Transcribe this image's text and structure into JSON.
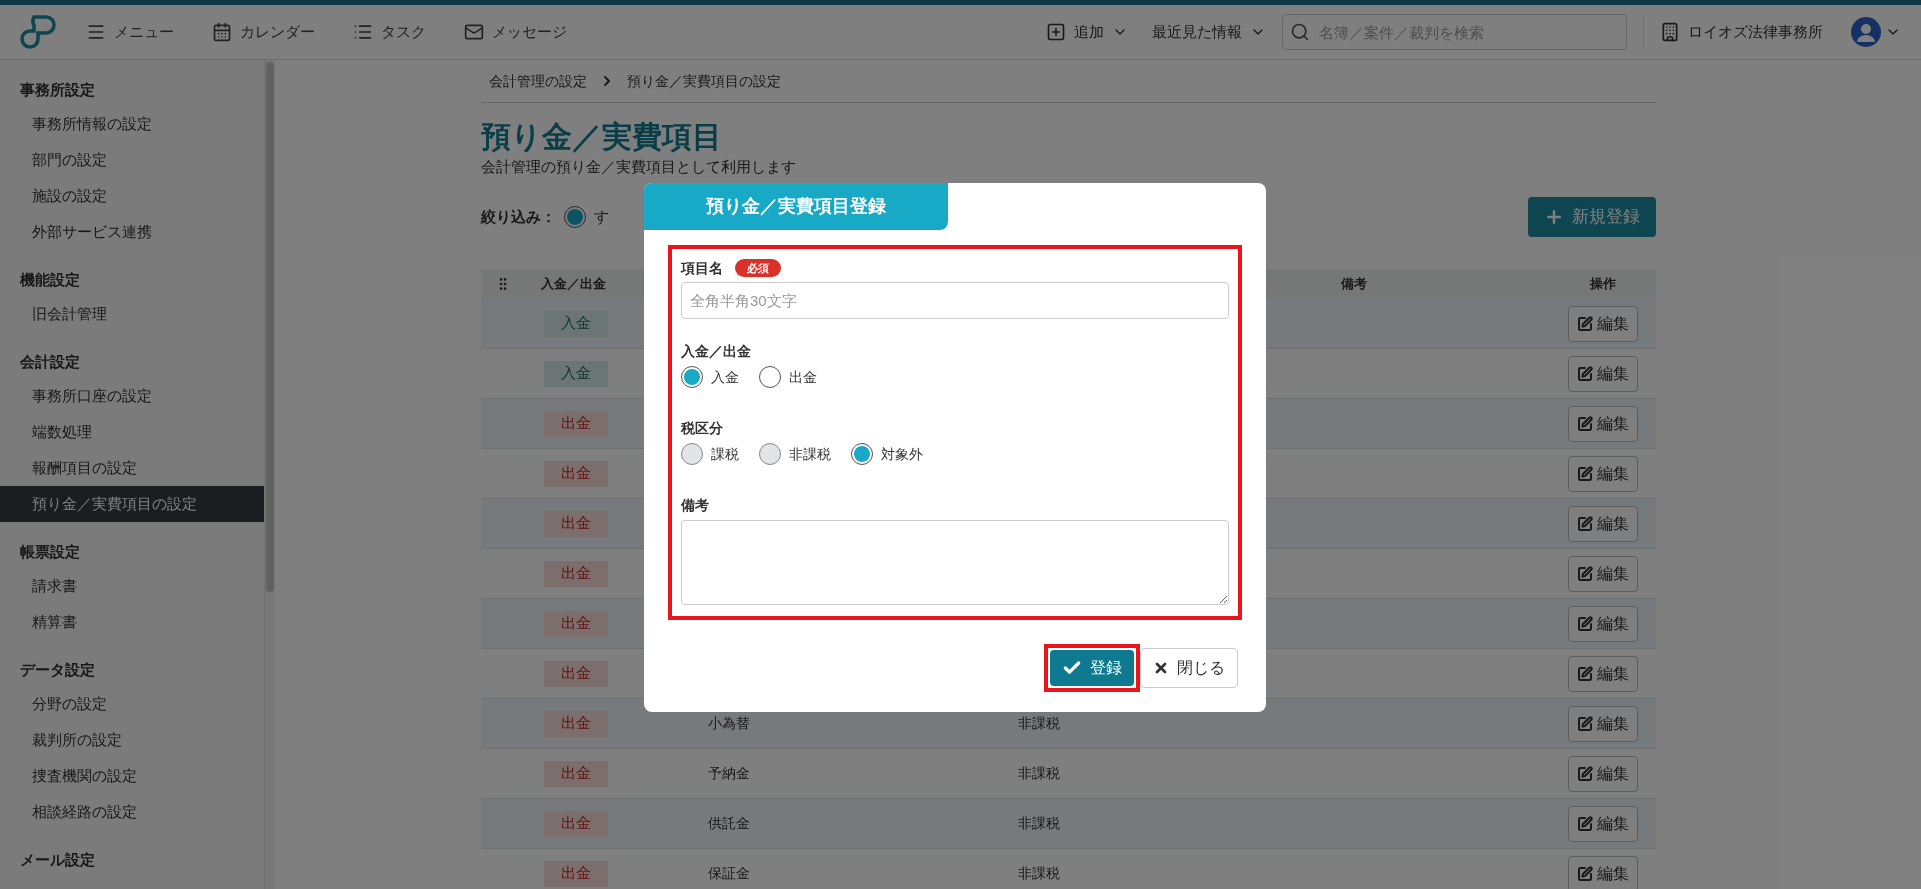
{
  "header": {
    "nav": [
      {
        "kind": "menu",
        "label": "メニュー"
      },
      {
        "kind": "calendar",
        "label": "カレンダー"
      },
      {
        "kind": "task",
        "label": "タスク"
      },
      {
        "kind": "message",
        "label": "メッセージ"
      }
    ],
    "add": "追加",
    "recent": "最近見た情報",
    "search": {
      "placeholder": "名簿／案件／裁判を検索"
    },
    "office": "ロイオズ法律事務所"
  },
  "sidebar": [
    {
      "title": "事務所設定",
      "items": [
        {
          "label": "事務所情報の設定",
          "selected": false
        },
        {
          "label": "部門の設定",
          "selected": false
        },
        {
          "label": "施設の設定",
          "selected": false
        },
        {
          "label": "外部サービス連携",
          "selected": false
        }
      ]
    },
    {
      "title": "機能設定",
      "items": [
        {
          "label": "旧会計管理",
          "selected": false
        }
      ]
    },
    {
      "title": "会計設定",
      "items": [
        {
          "label": "事務所口座の設定",
          "selected": false
        },
        {
          "label": "端数処理",
          "selected": false
        },
        {
          "label": "報酬項目の設定",
          "selected": false
        },
        {
          "label": "預り金／実費項目の設定",
          "selected": true
        }
      ]
    },
    {
      "title": "帳票設定",
      "items": [
        {
          "label": "請求書",
          "selected": false
        },
        {
          "label": "精算書",
          "selected": false
        }
      ]
    },
    {
      "title": "データ設定",
      "items": [
        {
          "label": "分野の設定",
          "selected": false
        },
        {
          "label": "裁判所の設定",
          "selected": false
        },
        {
          "label": "捜査機関の設定",
          "selected": false
        },
        {
          "label": "相談経路の設定",
          "selected": false
        }
      ]
    },
    {
      "title": "メール設定"
    }
  ],
  "breadcrumb": [
    "会計管理の設定",
    "預り金／実費項目の設定"
  ],
  "page": {
    "title": "預り金／実費項目",
    "description": "会計管理の預り金／実費項目として利用します",
    "filter": {
      "label": "絞り込み：",
      "option": {
        "label": "す",
        "selected": true
      }
    },
    "new_button": "新規登録"
  },
  "table": {
    "columns": {
      "type": "入金／出金",
      "note": "備考",
      "action": "操作"
    },
    "rows": [
      {
        "kind": "in",
        "type": "入金",
        "action": "編集"
      },
      {
        "kind": "in",
        "type": "入金",
        "action": "編集"
      },
      {
        "kind": "out",
        "type": "出金",
        "action": "編集"
      },
      {
        "kind": "out",
        "type": "出金",
        "action": "編集"
      },
      {
        "kind": "out",
        "type": "出金",
        "action": "編集"
      },
      {
        "kind": "out",
        "type": "出金",
        "action": "編集"
      },
      {
        "kind": "out",
        "type": "出金",
        "action": "編集"
      },
      {
        "kind": "out",
        "type": "出金",
        "action": "編集"
      },
      {
        "kind": "out",
        "type": "出金",
        "name": "小為替",
        "tax": "非課税",
        "action": "編集"
      },
      {
        "kind": "out",
        "type": "出金",
        "name": "予納金",
        "tax": "非課税",
        "action": "編集"
      },
      {
        "kind": "out",
        "type": "出金",
        "name": "供託金",
        "tax": "非課税",
        "action": "編集"
      },
      {
        "kind": "out",
        "type": "出金",
        "name": "保証金",
        "tax": "非課税",
        "action": "編集"
      }
    ]
  },
  "modal": {
    "title": "預り金／実費項目登録",
    "highlighted": true,
    "name": {
      "label": "項目名",
      "required": "必須",
      "placeholder": "全角半角30文字"
    },
    "direction": {
      "label": "入金／出金",
      "options": [
        {
          "label": "入金",
          "selected": true
        },
        {
          "label": "出金",
          "selected": false
        }
      ]
    },
    "tax": {
      "label": "税区分",
      "options": [
        {
          "label": "課税",
          "selected": false,
          "disabled": true
        },
        {
          "label": "非課税",
          "selected": false,
          "disabled": true
        },
        {
          "label": "対象外",
          "selected": true,
          "disabled": false
        }
      ]
    },
    "note": {
      "label": "備考"
    },
    "buttons": [
      {
        "kind": "primary",
        "label": "登録",
        "highlighted": true
      },
      {
        "kind": "secondary",
        "label": "閉じる",
        "highlighted": false
      }
    ]
  }
}
